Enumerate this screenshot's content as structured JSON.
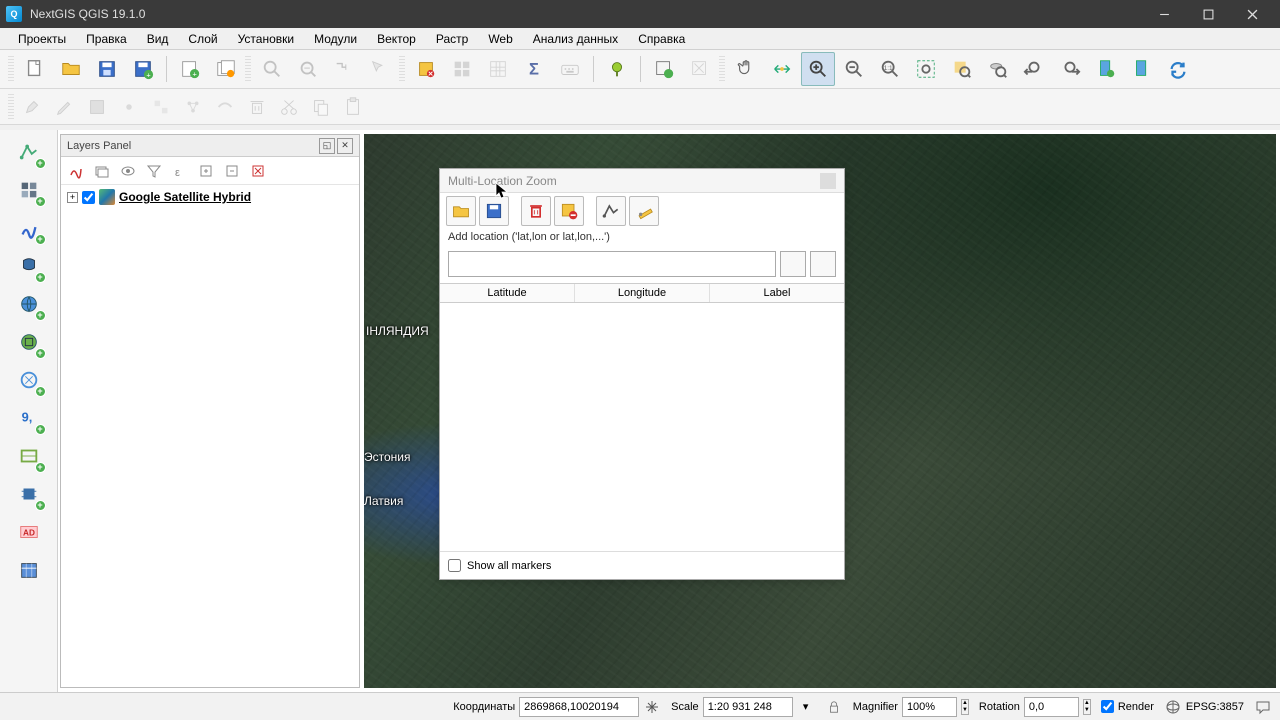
{
  "app": {
    "title": "NextGIS QGIS 19.1.0"
  },
  "menu": [
    "Проекты",
    "Правка",
    "Вид",
    "Слой",
    "Установки",
    "Модули",
    "Вектор",
    "Растр",
    "Web",
    "Анализ данных",
    "Справка"
  ],
  "layers_panel": {
    "title": "Layers Panel",
    "layer": "Google Satellite Hybrid"
  },
  "map_labels": {
    "finland": "ІНЛЯНДИЯ",
    "estonia": "Эстония",
    "latvia": "Латвия"
  },
  "mlz": {
    "title": "Multi-Location Zoom",
    "addlabel": "Add location ('lat,lon or lat,lon,...')",
    "col1": "Latitude",
    "col2": "Longitude",
    "col3": "Label",
    "showall": "Show all markers"
  },
  "status": {
    "coord_label": "Координаты",
    "coord_value": "2869868,10020194",
    "scale_label": "Scale",
    "scale_value": "1:20 931 248",
    "mag_label": "Magnifier",
    "mag_value": "100%",
    "rot_label": "Rotation",
    "rot_value": "0,0",
    "render": "Render",
    "epsg": "EPSG:3857"
  }
}
